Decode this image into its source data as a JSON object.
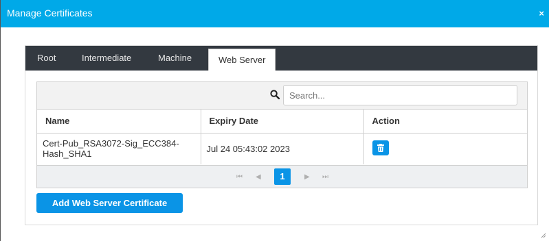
{
  "dialog": {
    "title": "Manage Certificates",
    "close_glyph": "×"
  },
  "tabs": [
    {
      "label": "Root",
      "active": false
    },
    {
      "label": "Intermediate",
      "active": false
    },
    {
      "label": "Machine",
      "active": false
    },
    {
      "label": "Web Server",
      "active": true
    }
  ],
  "search": {
    "placeholder": "Search...",
    "value": "",
    "icon": "search-icon"
  },
  "table": {
    "columns": [
      "Name",
      "Expiry Date",
      "Action"
    ],
    "rows": [
      {
        "name": "Cert-Pub_RSA3072-Sig_ECC384-Hash_SHA1",
        "expiry": "Jul 24 05:43:02 2023",
        "action_icon": "trash-icon"
      }
    ]
  },
  "pagination": {
    "first": "⏮",
    "prev": "◀",
    "current": "1",
    "next": "▶",
    "last": "⏭"
  },
  "add_button_label": "Add Web Server Certificate",
  "colors": {
    "accent": "#00a9e8",
    "button": "#0a94e6",
    "tabbar": "#333940"
  }
}
